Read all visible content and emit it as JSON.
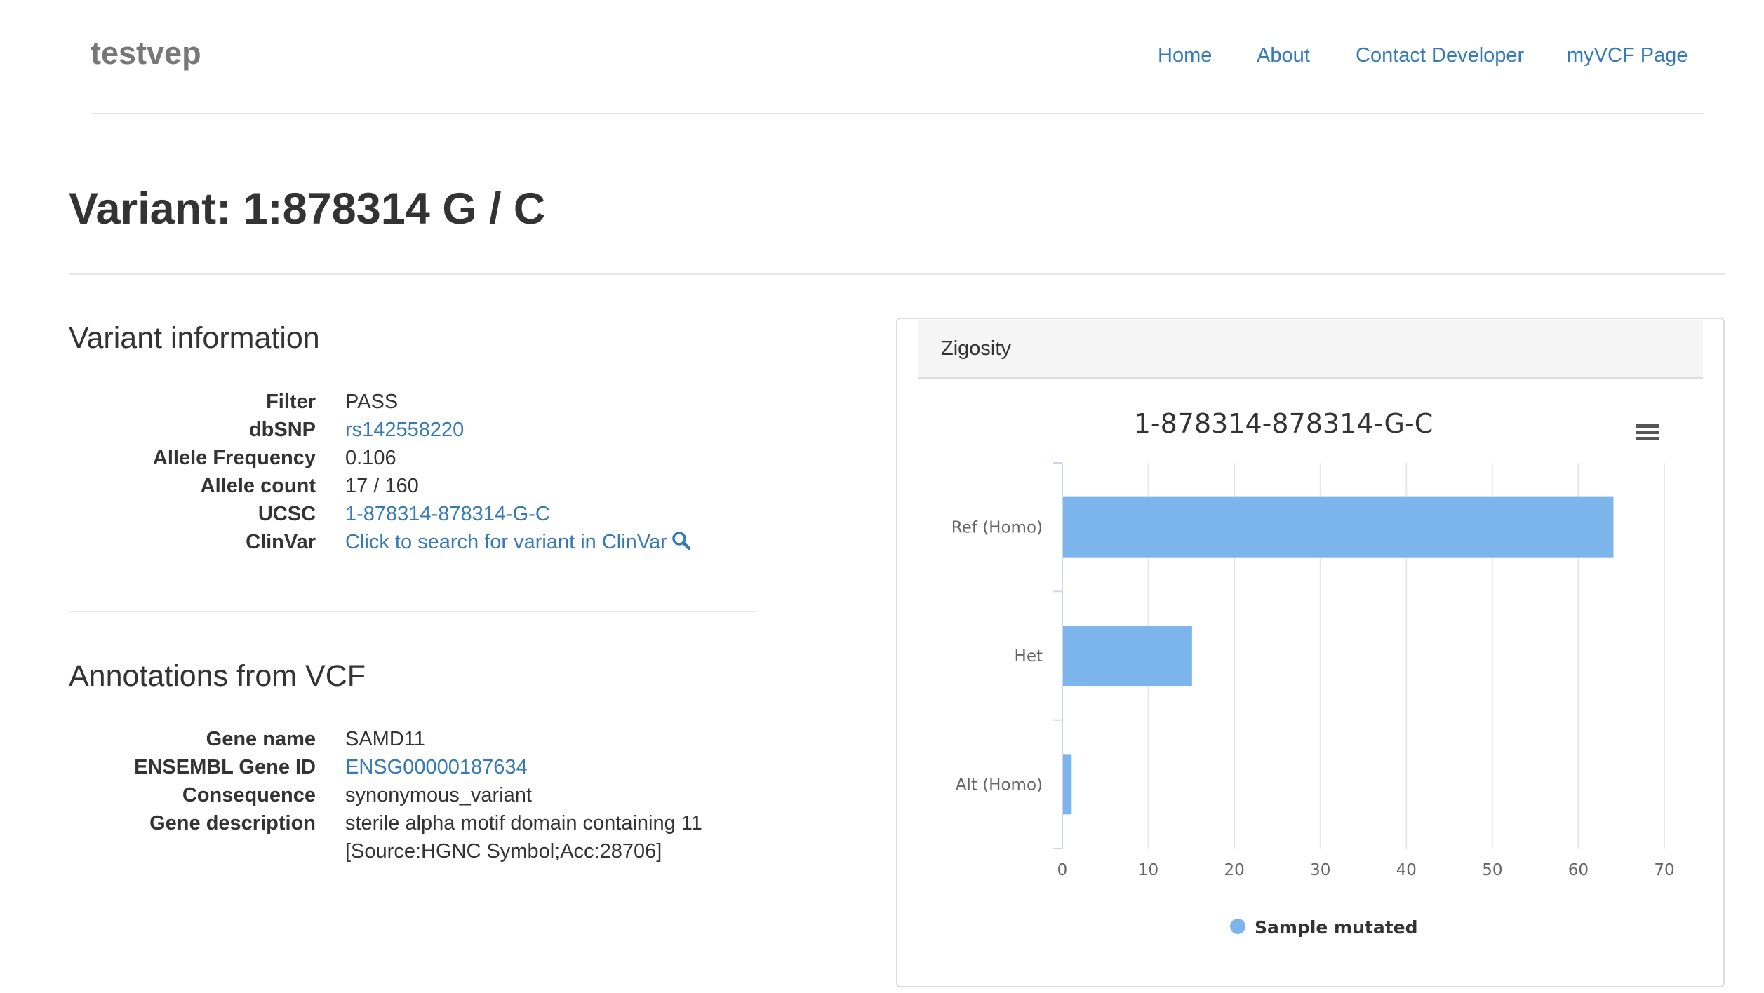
{
  "navbar": {
    "brand": "testvep",
    "links": [
      "Home",
      "About",
      "Contact Developer",
      "myVCF Page"
    ]
  },
  "page_title": "Variant: 1:878314 G / C",
  "variant_info": {
    "title": "Variant information",
    "rows": [
      {
        "label": "Filter",
        "value": "PASS",
        "link": false
      },
      {
        "label": "dbSNP",
        "value": "rs142558220",
        "link": true
      },
      {
        "label": "Allele Frequency",
        "value": "0.106",
        "link": false
      },
      {
        "label": "Allele count",
        "value": "17 / 160",
        "link": false
      },
      {
        "label": "UCSC",
        "value": "1-878314-878314-G-C",
        "link": true
      },
      {
        "label": "ClinVar",
        "value": "Click to search for variant in ClinVar",
        "link": true
      }
    ]
  },
  "annotations": {
    "title": "Annotations from VCF",
    "rows": [
      {
        "label": "Gene name",
        "value": "SAMD11",
        "link": false
      },
      {
        "label": "ENSEMBL Gene ID",
        "value": "ENSG00000187634",
        "link": true
      },
      {
        "label": "Consequence",
        "value": "synonymous_variant",
        "link": false
      },
      {
        "label": "Gene description",
        "value": "sterile alpha motif domain containing 11",
        "link": false
      },
      {
        "label": "",
        "value": "[Source:HGNC Symbol;Acc:28706]",
        "link": false
      }
    ]
  },
  "zigosity_panel": {
    "heading": "Zigosity",
    "menu_icon": "hamburger-menu-icon"
  },
  "chart_data": {
    "type": "bar",
    "orientation": "horizontal",
    "title": "1-878314-878314-G-C",
    "categories": [
      "Ref (Homo)",
      "Het",
      "Alt (Homo)"
    ],
    "series": [
      {
        "name": "Sample mutated",
        "values": [
          64,
          15,
          1
        ],
        "color": "#7cb5ec"
      }
    ],
    "xlim": [
      0,
      70
    ],
    "xticks": [
      0,
      10,
      20,
      30,
      40,
      50,
      60,
      70
    ],
    "grid": true,
    "legend": "bottom-center"
  },
  "colors": {
    "link": "#337ab7",
    "bar": "#7cb5ec"
  }
}
